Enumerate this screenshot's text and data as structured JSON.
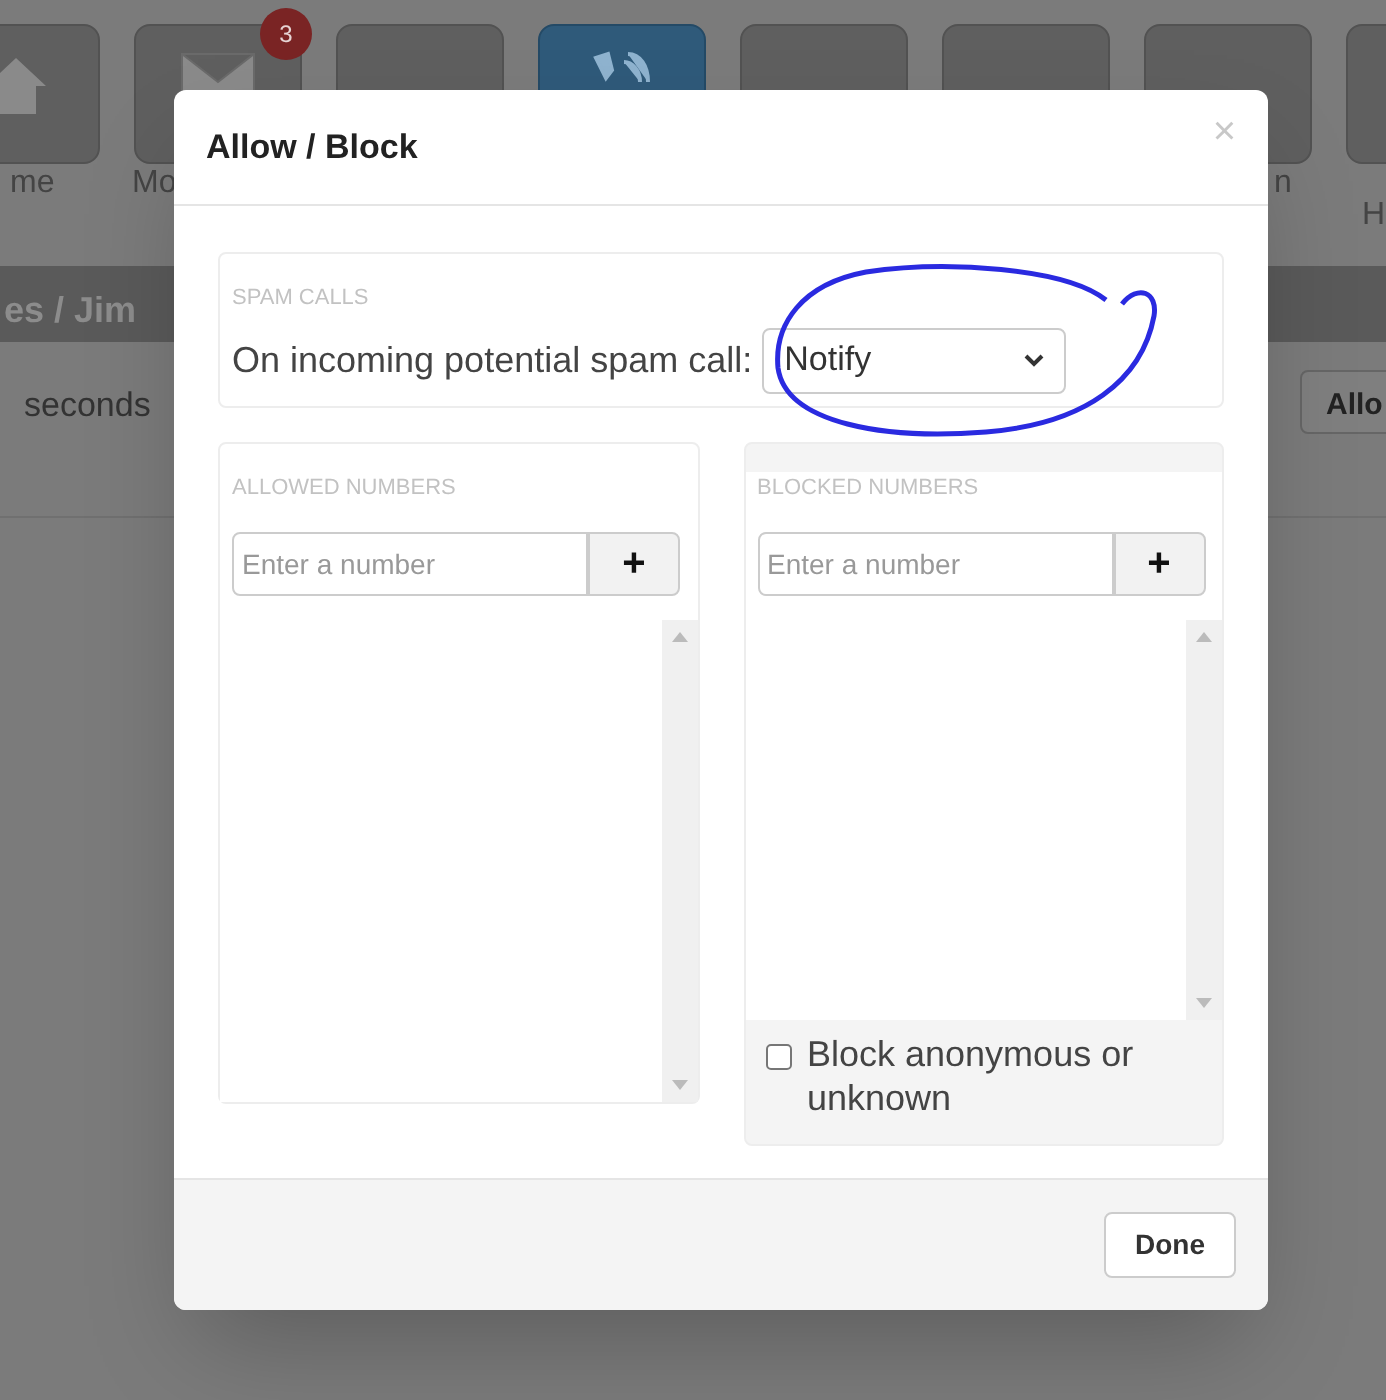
{
  "nav_tiles": [
    {
      "label": "me",
      "selected": false
    },
    {
      "label": "Mo",
      "selected": false,
      "badge": "3"
    },
    {
      "selected": false
    },
    {
      "selected": true
    },
    {
      "selected": false
    },
    {
      "selected": false
    },
    {
      "label": "n",
      "selected": false
    },
    {
      "label": "H",
      "selected": false
    }
  ],
  "breadcrumb": "es / Jim",
  "row_text": "seconds",
  "row_button": "Allo",
  "dialog": {
    "title": "Allow / Block",
    "close": "×",
    "spam": {
      "heading": "SPAM CALLS",
      "label": "On incoming potential spam call:",
      "value": "Notify"
    },
    "lists": [
      {
        "kind": "plain",
        "heading": "ALLOWED NUMBERS",
        "placeholder": "Enter a number",
        "add": "+"
      },
      {
        "kind": "with_option",
        "heading": "BLOCKED NUMBERS",
        "placeholder": "Enter a number",
        "add": "+",
        "option": {
          "label": "Block anonymous or unknown",
          "checked": false
        }
      }
    ],
    "done": "Done"
  }
}
